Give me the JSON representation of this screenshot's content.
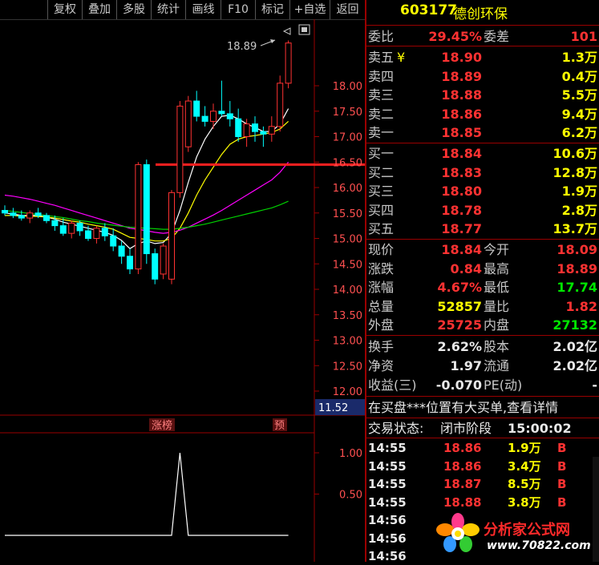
{
  "toolbar": {
    "buttons": [
      "复权",
      "叠加",
      "多股",
      "统计",
      "画线",
      "F10",
      "标记",
      "+自选",
      "返回"
    ]
  },
  "chart": {
    "price_axis": [
      "18.00",
      "17.50",
      "17.00",
      "16.50",
      "16.00",
      "15.50",
      "15.00",
      "14.50",
      "14.00",
      "13.50",
      "13.00",
      "12.50",
      "12.00"
    ],
    "current_price_tag": "11.52",
    "high_label": "18.89",
    "indicator_axis": [
      "1.00",
      "0.50"
    ],
    "indicator_labels": {
      "zhangbang": "涨榜",
      "yu": "预"
    }
  },
  "chart_data": {
    "type": "candlestick",
    "title": "",
    "ylim": [
      11.9,
      18.4
    ],
    "candles": [
      {
        "o": 15.55,
        "h": 15.65,
        "l": 15.45,
        "c": 15.5
      },
      {
        "o": 15.5,
        "h": 15.6,
        "l": 15.4,
        "c": 15.45
      },
      {
        "o": 15.45,
        "h": 15.55,
        "l": 15.35,
        "c": 15.4
      },
      {
        "o": 15.4,
        "h": 15.55,
        "l": 15.3,
        "c": 15.5
      },
      {
        "o": 15.5,
        "h": 15.6,
        "l": 15.4,
        "c": 15.45
      },
      {
        "o": 15.45,
        "h": 15.5,
        "l": 15.3,
        "c": 15.35
      },
      {
        "o": 15.35,
        "h": 15.45,
        "l": 15.15,
        "c": 15.25
      },
      {
        "o": 15.25,
        "h": 15.4,
        "l": 15.05,
        "c": 15.1
      },
      {
        "o": 15.1,
        "h": 15.35,
        "l": 15.0,
        "c": 15.3
      },
      {
        "o": 15.3,
        "h": 15.35,
        "l": 15.05,
        "c": 15.15
      },
      {
        "o": 15.15,
        "h": 15.25,
        "l": 14.95,
        "c": 15.0
      },
      {
        "o": 15.0,
        "h": 15.25,
        "l": 14.9,
        "c": 15.2
      },
      {
        "o": 15.2,
        "h": 15.3,
        "l": 14.95,
        "c": 15.05
      },
      {
        "o": 15.05,
        "h": 15.2,
        "l": 14.75,
        "c": 14.85
      },
      {
        "o": 14.85,
        "h": 14.95,
        "l": 14.5,
        "c": 14.65
      },
      {
        "o": 14.65,
        "h": 14.8,
        "l": 14.3,
        "c": 14.4
      },
      {
        "o": 14.4,
        "h": 16.5,
        "l": 14.3,
        "c": 16.45
      },
      {
        "o": 16.45,
        "h": 16.55,
        "l": 14.5,
        "c": 14.7
      },
      {
        "o": 14.7,
        "h": 14.8,
        "l": 14.1,
        "c": 14.2
      },
      {
        "o": 14.3,
        "h": 14.9,
        "l": 14.2,
        "c": 14.85
      },
      {
        "o": 14.2,
        "h": 15.95,
        "l": 14.1,
        "c": 15.9
      },
      {
        "o": 15.9,
        "h": 17.7,
        "l": 15.8,
        "c": 17.6
      },
      {
        "o": 16.8,
        "h": 17.8,
        "l": 16.7,
        "c": 17.7
      },
      {
        "o": 17.7,
        "h": 17.9,
        "l": 17.3,
        "c": 17.4
      },
      {
        "o": 17.4,
        "h": 17.6,
        "l": 17.2,
        "c": 17.3
      },
      {
        "o": 17.3,
        "h": 17.65,
        "l": 17.15,
        "c": 17.5
      },
      {
        "o": 17.5,
        "h": 18.1,
        "l": 17.4,
        "c": 17.45
      },
      {
        "o": 17.45,
        "h": 17.7,
        "l": 17.2,
        "c": 17.35
      },
      {
        "o": 17.35,
        "h": 17.55,
        "l": 16.9,
        "c": 17.0
      },
      {
        "o": 17.0,
        "h": 17.35,
        "l": 16.8,
        "c": 17.25
      },
      {
        "o": 17.25,
        "h": 17.4,
        "l": 16.9,
        "c": 17.1
      },
      {
        "o": 17.1,
        "h": 17.2,
        "l": 16.8,
        "c": 17.05
      },
      {
        "o": 17.05,
        "h": 17.4,
        "l": 16.9,
        "c": 17.2
      },
      {
        "o": 17.2,
        "h": 18.2,
        "l": 17.1,
        "c": 18.05
      },
      {
        "o": 18.05,
        "h": 18.89,
        "l": 17.95,
        "c": 18.84
      }
    ],
    "ma_series": [
      {
        "color": "#ffffff",
        "values": [
          15.5,
          15.48,
          15.45,
          15.45,
          15.45,
          15.42,
          15.38,
          15.32,
          15.28,
          15.24,
          15.2,
          15.16,
          15.12,
          15.06,
          14.96,
          14.8,
          14.9,
          14.95,
          14.9,
          14.92,
          15.1,
          15.55,
          16.1,
          16.6,
          16.95,
          17.2,
          17.4,
          17.42,
          17.35,
          17.25,
          17.18,
          17.1,
          17.1,
          17.25,
          17.55
        ]
      },
      {
        "color": "#ffff00",
        "values": [
          15.45,
          15.45,
          15.44,
          15.44,
          15.43,
          15.42,
          15.4,
          15.37,
          15.34,
          15.32,
          15.28,
          15.25,
          15.22,
          15.18,
          15.1,
          15.02,
          15.0,
          14.98,
          14.95,
          14.95,
          15.0,
          15.2,
          15.5,
          15.85,
          16.15,
          16.4,
          16.65,
          16.85,
          16.95,
          17.0,
          17.02,
          17.05,
          17.08,
          17.15,
          17.3
        ]
      },
      {
        "color": "#ff00ff",
        "values": [
          15.85,
          15.83,
          15.8,
          15.77,
          15.73,
          15.69,
          15.65,
          15.6,
          15.55,
          15.5,
          15.45,
          15.4,
          15.35,
          15.3,
          15.25,
          15.2,
          15.18,
          15.15,
          15.12,
          15.1,
          15.12,
          15.16,
          15.22,
          15.3,
          15.38,
          15.46,
          15.55,
          15.65,
          15.75,
          15.85,
          15.95,
          16.05,
          16.15,
          16.3,
          16.5
        ]
      },
      {
        "color": "#00d000",
        "values": [
          15.55,
          15.53,
          15.51,
          15.49,
          15.47,
          15.45,
          15.43,
          15.41,
          15.38,
          15.35,
          15.33,
          15.3,
          15.28,
          15.26,
          15.24,
          15.22,
          15.21,
          15.2,
          15.19,
          15.18,
          15.18,
          15.2,
          15.22,
          15.25,
          15.28,
          15.32,
          15.36,
          15.4,
          15.44,
          15.48,
          15.52,
          15.56,
          15.6,
          15.66,
          15.73
        ]
      }
    ],
    "indicator": {
      "values": [
        0,
        0,
        0,
        0,
        0,
        0,
        0,
        0,
        0,
        0,
        0,
        0,
        0,
        0,
        0,
        0,
        0,
        0,
        0,
        0,
        0,
        1,
        0,
        0,
        0,
        0,
        0,
        0,
        0,
        0,
        0,
        0,
        0,
        0,
        0
      ],
      "ylim": [
        0,
        1.1
      ]
    }
  },
  "stock": {
    "code": "603177",
    "name": "德创环保"
  },
  "weibi": {
    "label": "委比",
    "value": "29.45%",
    "label2": "委差",
    "value2": "101"
  },
  "asks": [
    {
      "label": "卖五",
      "flag": "¥",
      "price": "18.90",
      "vol": "1.3万"
    },
    {
      "label": "卖四",
      "flag": "",
      "price": "18.89",
      "vol": "0.4万"
    },
    {
      "label": "卖三",
      "flag": "",
      "price": "18.88",
      "vol": "5.5万"
    },
    {
      "label": "卖二",
      "flag": "",
      "price": "18.86",
      "vol": "9.4万"
    },
    {
      "label": "卖一",
      "flag": "",
      "price": "18.85",
      "vol": "6.2万"
    }
  ],
  "bids": [
    {
      "label": "买一",
      "price": "18.84",
      "vol": "10.6万"
    },
    {
      "label": "买二",
      "price": "18.83",
      "vol": "12.8万"
    },
    {
      "label": "买三",
      "price": "18.80",
      "vol": "1.9万"
    },
    {
      "label": "买四",
      "price": "18.78",
      "vol": "2.8万"
    },
    {
      "label": "买五",
      "price": "18.77",
      "vol": "13.7万"
    }
  ],
  "quote": [
    {
      "l1": "现价",
      "v1": "18.84",
      "l2": "今开",
      "v2": "18.09"
    },
    {
      "l1": "涨跌",
      "v1": "0.84",
      "l2": "最高",
      "v2": "18.89"
    },
    {
      "l1": "涨幅",
      "v1": "4.67%",
      "l2": "最低",
      "v2": "17.74"
    },
    {
      "l1": "总量",
      "v1": "52857",
      "l2": "量比",
      "v2": "1.82"
    },
    {
      "l1": "外盘",
      "v1": "25725",
      "l2": "内盘",
      "v2": "27132"
    }
  ],
  "finance": [
    {
      "l1": "换手",
      "v1": "2.62%",
      "l2": "股本",
      "v2": "2.02亿"
    },
    {
      "l1": "净资",
      "v1": "1.97",
      "l2": "流通",
      "v2": "2.02亿"
    },
    {
      "l1": "收益(三)",
      "v1": "-0.070",
      "l2": "PE(动)",
      "v2": "-"
    }
  ],
  "notice": "在买盘***位置有大买单,查看详情",
  "trade_status": {
    "label": "交易状态:",
    "value": "闭市阶段",
    "time": "15:00:02"
  },
  "ticks": [
    {
      "time": "14:55",
      "price": "18.86",
      "vol": "1.9万",
      "side": "B"
    },
    {
      "time": "14:55",
      "price": "18.86",
      "vol": "3.4万",
      "side": "B"
    },
    {
      "time": "14:55",
      "price": "18.87",
      "vol": "8.5万",
      "side": "B"
    },
    {
      "time": "14:55",
      "price": "18.88",
      "vol": "3.8万",
      "side": "B"
    },
    {
      "time": "14:56",
      "price": "",
      "vol": "",
      "side": ""
    },
    {
      "time": "14:56",
      "price": "",
      "vol": "",
      "side": ""
    },
    {
      "time": "14:56",
      "price": "",
      "vol": "",
      "side": ""
    }
  ],
  "watermark": {
    "brand": "分析家公式网",
    "url": "www.70822.com"
  },
  "colors": {
    "up": "#ff3232",
    "down": "#00ffff",
    "bg": "#000000",
    "grid_red": "#9a0000"
  }
}
